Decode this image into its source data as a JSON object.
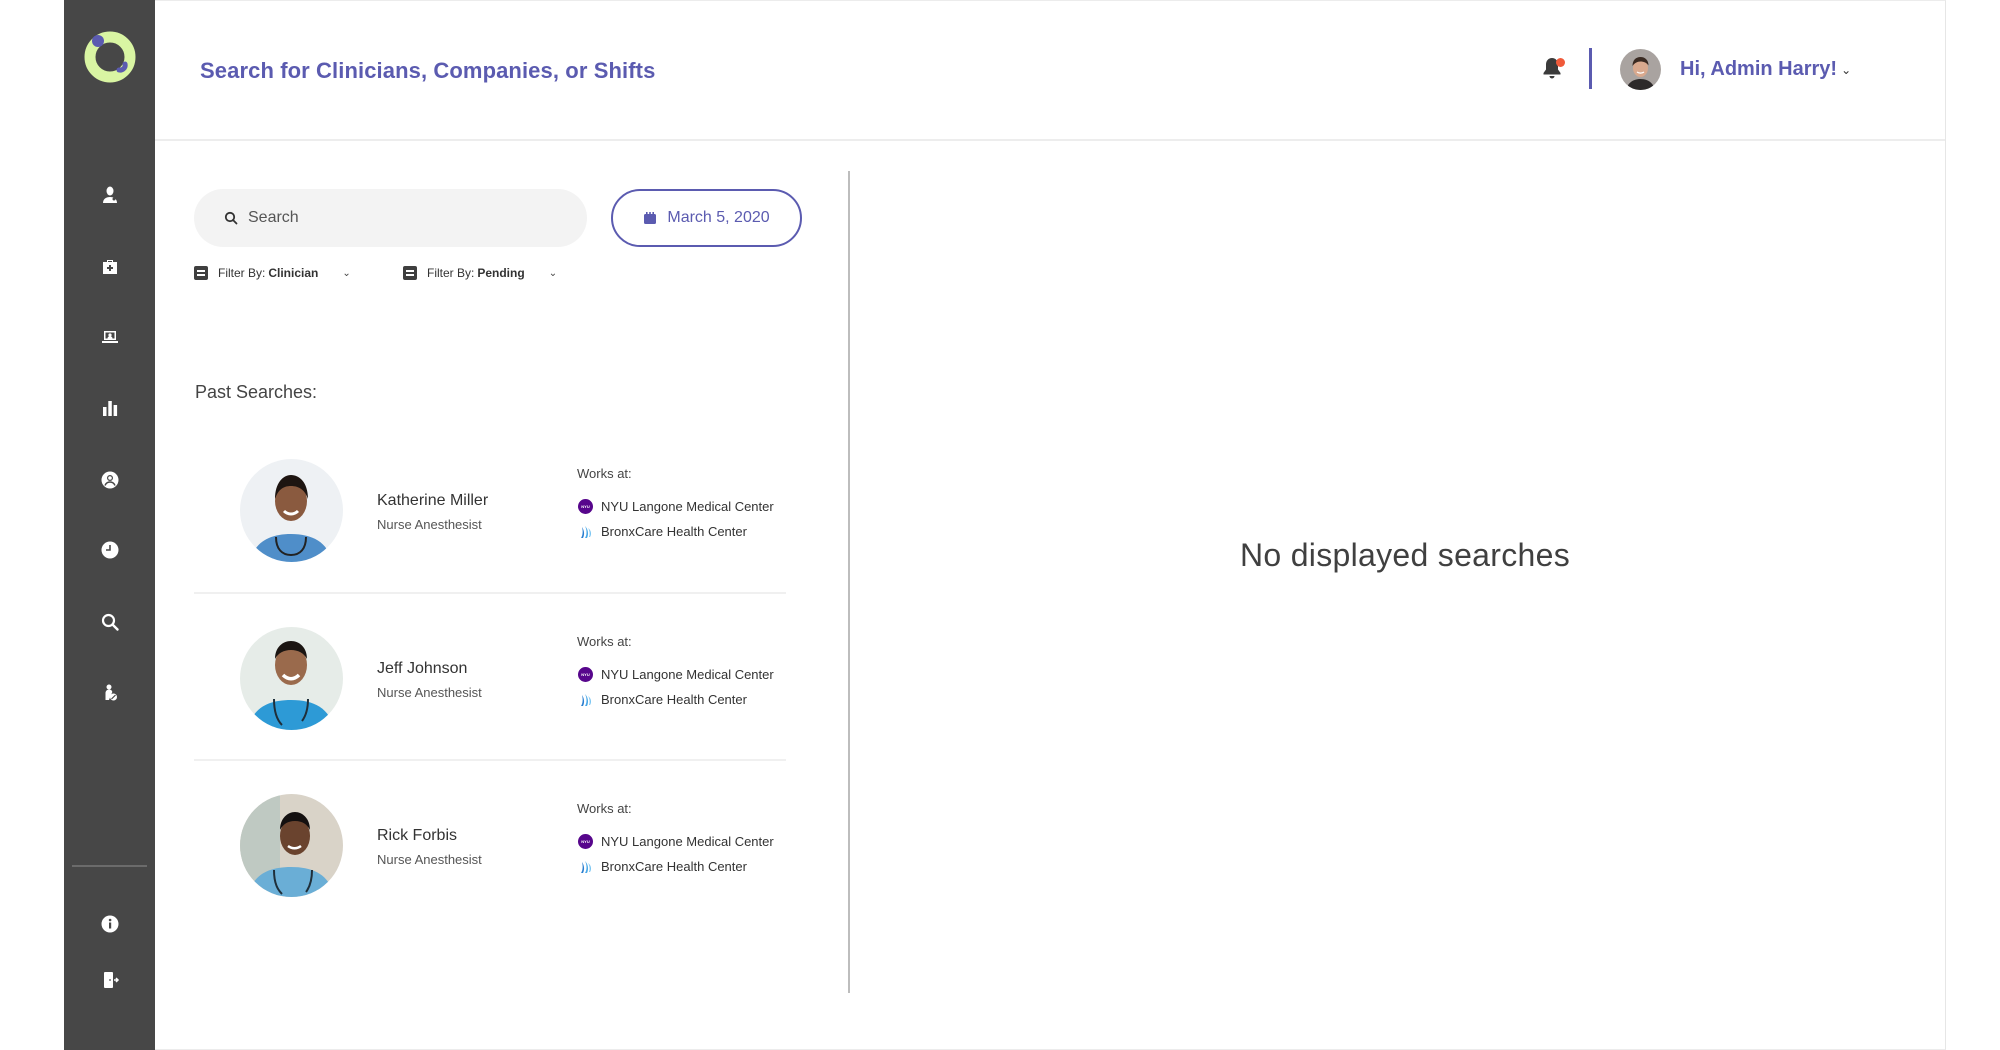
{
  "header": {
    "title": "Search for Clinicians, Companies, or Shifts",
    "greeting": "Hi, Admin Harry!",
    "notification_unread": true
  },
  "sidebar": {
    "logo": "app-logo-ring",
    "items": [
      {
        "icon": "clinician-icon"
      },
      {
        "icon": "medical-kit-icon"
      },
      {
        "icon": "laptop-user-icon"
      },
      {
        "icon": "bar-chart-icon"
      },
      {
        "icon": "user-circle-icon"
      },
      {
        "icon": "clock-icon"
      },
      {
        "icon": "search-icon"
      },
      {
        "icon": "user-edit-icon"
      }
    ],
    "bottom_items": [
      {
        "icon": "info-icon"
      },
      {
        "icon": "logout-icon"
      }
    ]
  },
  "search": {
    "placeholder": "Search",
    "value": ""
  },
  "date_button": {
    "label": "March 5, 2020"
  },
  "filters": [
    {
      "prefix": "Filter By:",
      "value": "Clinician"
    },
    {
      "prefix": "Filter By:",
      "value": "Pending"
    }
  ],
  "past_searches": {
    "label": "Past Searches:",
    "items": [
      {
        "name": "Katherine Miller",
        "role": "Nurse Anesthesist",
        "works_at_label": "Works at:",
        "orgs": [
          "NYU Langone Medical Center",
          "BronxCare Health Center"
        ]
      },
      {
        "name": "Jeff Johnson",
        "role": "Nurse Anesthesist",
        "works_at_label": "Works at:",
        "orgs": [
          "NYU Langone Medical Center",
          "BronxCare Health Center"
        ]
      },
      {
        "name": "Rick Forbis",
        "role": "Nurse Anesthesist",
        "works_at_label": "Works at:",
        "orgs": [
          "NYU Langone Medical Center",
          "BronxCare Health Center"
        ]
      }
    ]
  },
  "results": {
    "empty_message": "No displayed searches"
  },
  "colors": {
    "accent": "#5b5bb0",
    "sidebar_bg": "#474747",
    "logo_ring": "#d9f5a3",
    "notification_dot": "#f05a3a",
    "nyu_purple": "#57068c"
  }
}
